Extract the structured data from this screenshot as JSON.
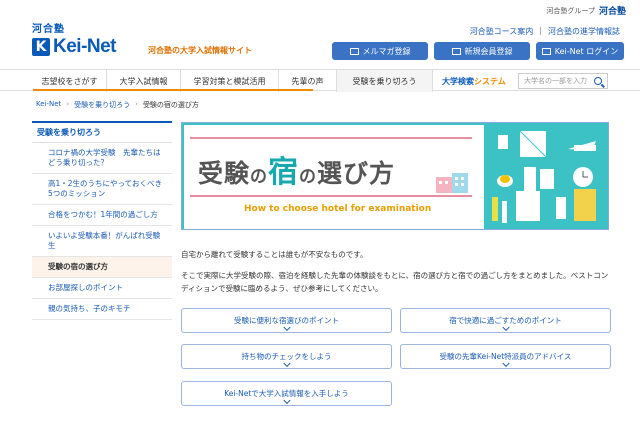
{
  "group": {
    "label": "河合塾グループ",
    "logo": "河合塾"
  },
  "logo": {
    "sub": "河合塾",
    "main": "Kei-Net",
    "k": "K"
  },
  "tagline": "河合塾の大学入試情報サイト",
  "toplinks": [
    "河合塾コース案内",
    "河合塾の進学情報誌"
  ],
  "buttons": [
    "メルマガ登録",
    "新規会員登録",
    "Kei-Net ログイン"
  ],
  "nav": {
    "items": [
      "志望校をさがす",
      "大学入試情報",
      "学習対策と模試活用",
      "先輩の声",
      "受験を乗り切ろう"
    ],
    "search_title_a": "大学検索",
    "search_title_b": "システム",
    "search_placeholder": "大学名の一部を入力"
  },
  "breadcrumb": [
    "Kei-Net",
    "受験を乗り切ろう",
    "受験の宿の選び方"
  ],
  "sidebar": {
    "heading": "受験を乗り切ろう",
    "items": [
      "コロナ禍の大学受験　先輩たちはどう乗り切った？",
      "高1・2生のうちにやっておくべき5つのミッション",
      "合格をつかむ！1年間の過ごし方",
      "いよいよ受験本番！がんばれ受験生",
      "受験の宿の選び方",
      "お部屋探しのポイント",
      "親の気持ち、子のキモチ"
    ],
    "active_index": 4
  },
  "hero": {
    "title_a": "受験",
    "title_b": "の",
    "title_c": "宿",
    "title_d": "の",
    "title_e": "選び方",
    "subtitle": "How to choose hotel for examination"
  },
  "intro": {
    "line1": "自宅から離れて受験することは誰もが不安なものです。",
    "line2": "そこで実際に大学受験の際、宿泊を経験した先輩の体験談をもとに、宿の選び方と宿での過ごし方をまとめました。ベストコンディションで受験に臨めるよう、ぜひ参考にしてください。"
  },
  "links": [
    "受験に便利な宿選びのポイント",
    "宿で快適に過ごすためのポイント",
    "持ち物のチェックをしよう",
    "受験の先輩Kei-Net特派員のアドバイス",
    "Kei-Netで大学入試情報を入手しよう"
  ],
  "colors": {
    "brand": "#0a5ab8",
    "accent": "#f08a00",
    "teal": "#3cc1c4",
    "pink": "#e88ca0"
  }
}
